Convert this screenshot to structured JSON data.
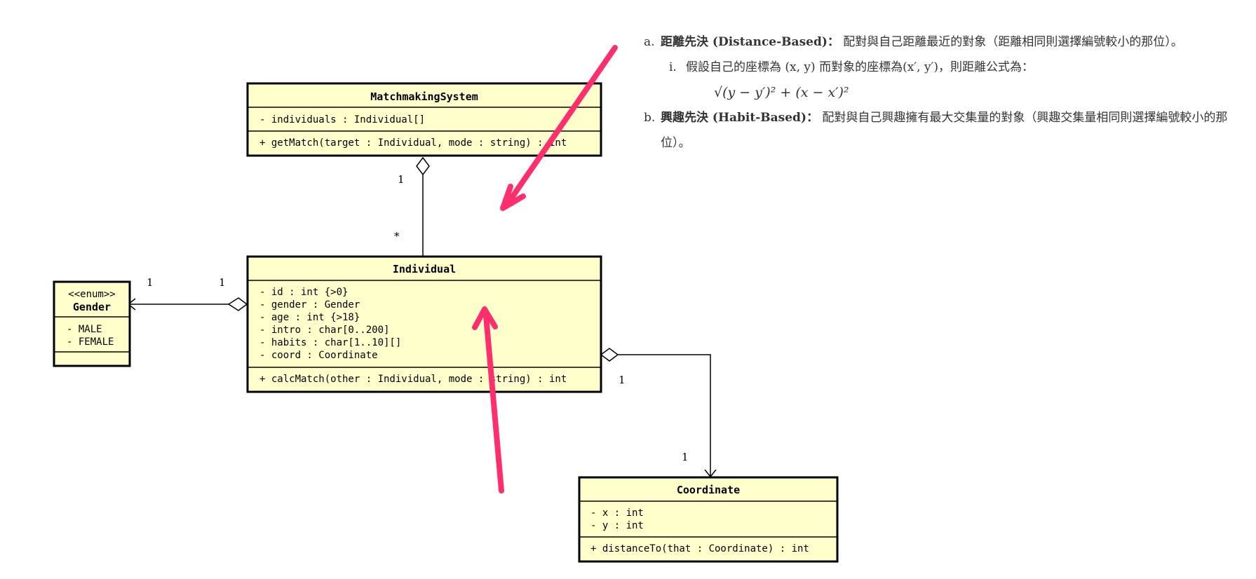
{
  "colors": {
    "class_fill": "#ffffcc",
    "border": "#000000",
    "arrow": "#ff2f6e",
    "notes_text": "#333333"
  },
  "classes": {
    "matchmaking": {
      "name": "MatchmakingSystem",
      "attributes": [
        "- individuals : Individual[]"
      ],
      "operations": [
        "+ getMatch(target : Individual, mode : string) : int"
      ]
    },
    "individual": {
      "name": "Individual",
      "attributes": [
        "- id : int {>0}",
        "- gender : Gender",
        "- age : int {>18}",
        "- intro : char[0..200]",
        "- habits : char[1..10][]",
        "- coord : Coordinate"
      ],
      "operations": [
        "+ calcMatch(other : Individual, mode : string) : int"
      ]
    },
    "gender": {
      "stereotype": "<<enum>>",
      "name": "Gender",
      "literals": [
        "- MALE",
        "- FEMALE"
      ]
    },
    "coordinate": {
      "name": "Coordinate",
      "attributes": [
        "- x : int",
        "- y : int"
      ],
      "operations": [
        "+ distanceTo(that : Coordinate) : int"
      ]
    }
  },
  "multiplicities": {
    "ms_side": "1",
    "ind_side": "*",
    "gender_left": "1",
    "gender_right": "1",
    "coord_top": "1",
    "coord_bottom": "1"
  },
  "notes": {
    "a": {
      "marker": "a.",
      "term": "距離先決 (Distance-Based)：",
      "text": "配對與自己距離最近的對象（距離相同則選擇編號較小的那位）。",
      "sub": {
        "marker": "i.",
        "text": "假設自己的座標為 (x, y) 而對象的座標為(x′, y′)，則距離公式為：",
        "formula": "√(y − y′)² + (x − x′)²"
      }
    },
    "b": {
      "marker": "b.",
      "term": "興趣先決 (Habit-Based)：",
      "text": "配對與自己興趣擁有最大交集量的對象（興趣交集量相同則選擇編號較小的那位）。"
    }
  }
}
